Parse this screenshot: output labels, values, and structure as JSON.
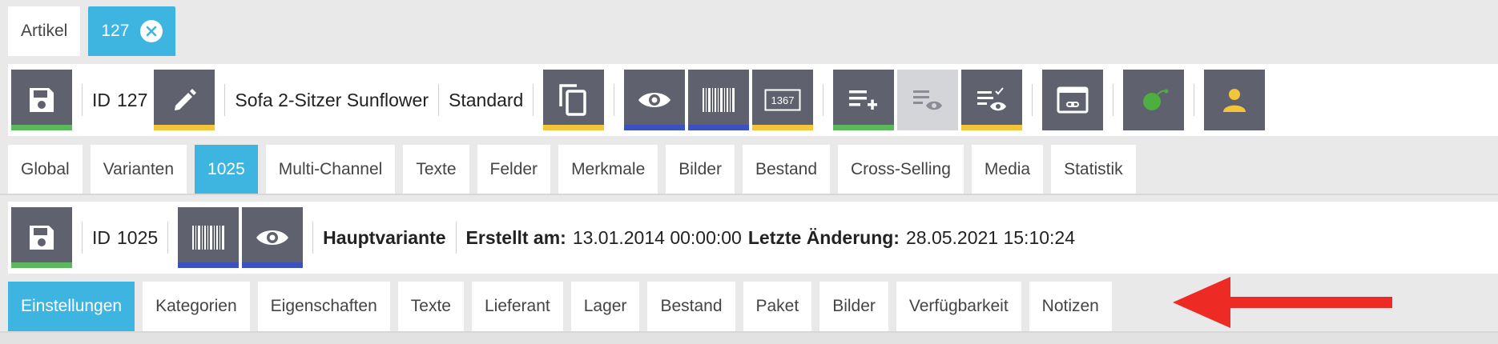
{
  "doc_tabs": [
    {
      "label": "Artikel",
      "active": false
    },
    {
      "label": "127",
      "active": true
    }
  ],
  "article_toolbar": {
    "id_label": "ID",
    "id_value": "127",
    "name": "Sofa 2-Sitzer Sunflower",
    "type": "Standard",
    "barcode_number_icon_text": "1367"
  },
  "article_tabs": [
    "Global",
    "Varianten",
    "1025",
    "Multi-Channel",
    "Texte",
    "Felder",
    "Merkmale",
    "Bilder",
    "Bestand",
    "Cross-Selling",
    "Media",
    "Statistik"
  ],
  "variant_toolbar": {
    "id_label": "ID",
    "id_value": "1025",
    "variant_type": "Hauptvariante",
    "created_label": "Erstellt am:",
    "created_value": "13.01.2014 00:00:00",
    "modified_label": "Letzte Änderung:",
    "modified_value": "28.05.2021 15:10:24"
  },
  "variant_tabs": [
    "Einstellungen",
    "Kategorien",
    "Eigenschaften",
    "Texte",
    "Lieferant",
    "Lager",
    "Bestand",
    "Paket",
    "Bilder",
    "Verfügbarkeit",
    "Notizen"
  ],
  "colors": {
    "accent_blue": "#3eb5e0",
    "button_gray": "#5f626e",
    "indicator_green": "#5cb85c",
    "indicator_yellow": "#f3c53a",
    "indicator_blue": "#3b50c1",
    "annotation_arrow": "#ee2a24"
  },
  "icons": [
    "floppy-disk-icon",
    "pencil-icon",
    "copy-icon",
    "eye-icon",
    "barcode-icon",
    "barcode-number-icon",
    "list-add-icon",
    "list-preview-icon",
    "list-check-preview-icon",
    "window-link-icon",
    "green-blob-icon",
    "user-icon",
    "close-circle-icon"
  ]
}
